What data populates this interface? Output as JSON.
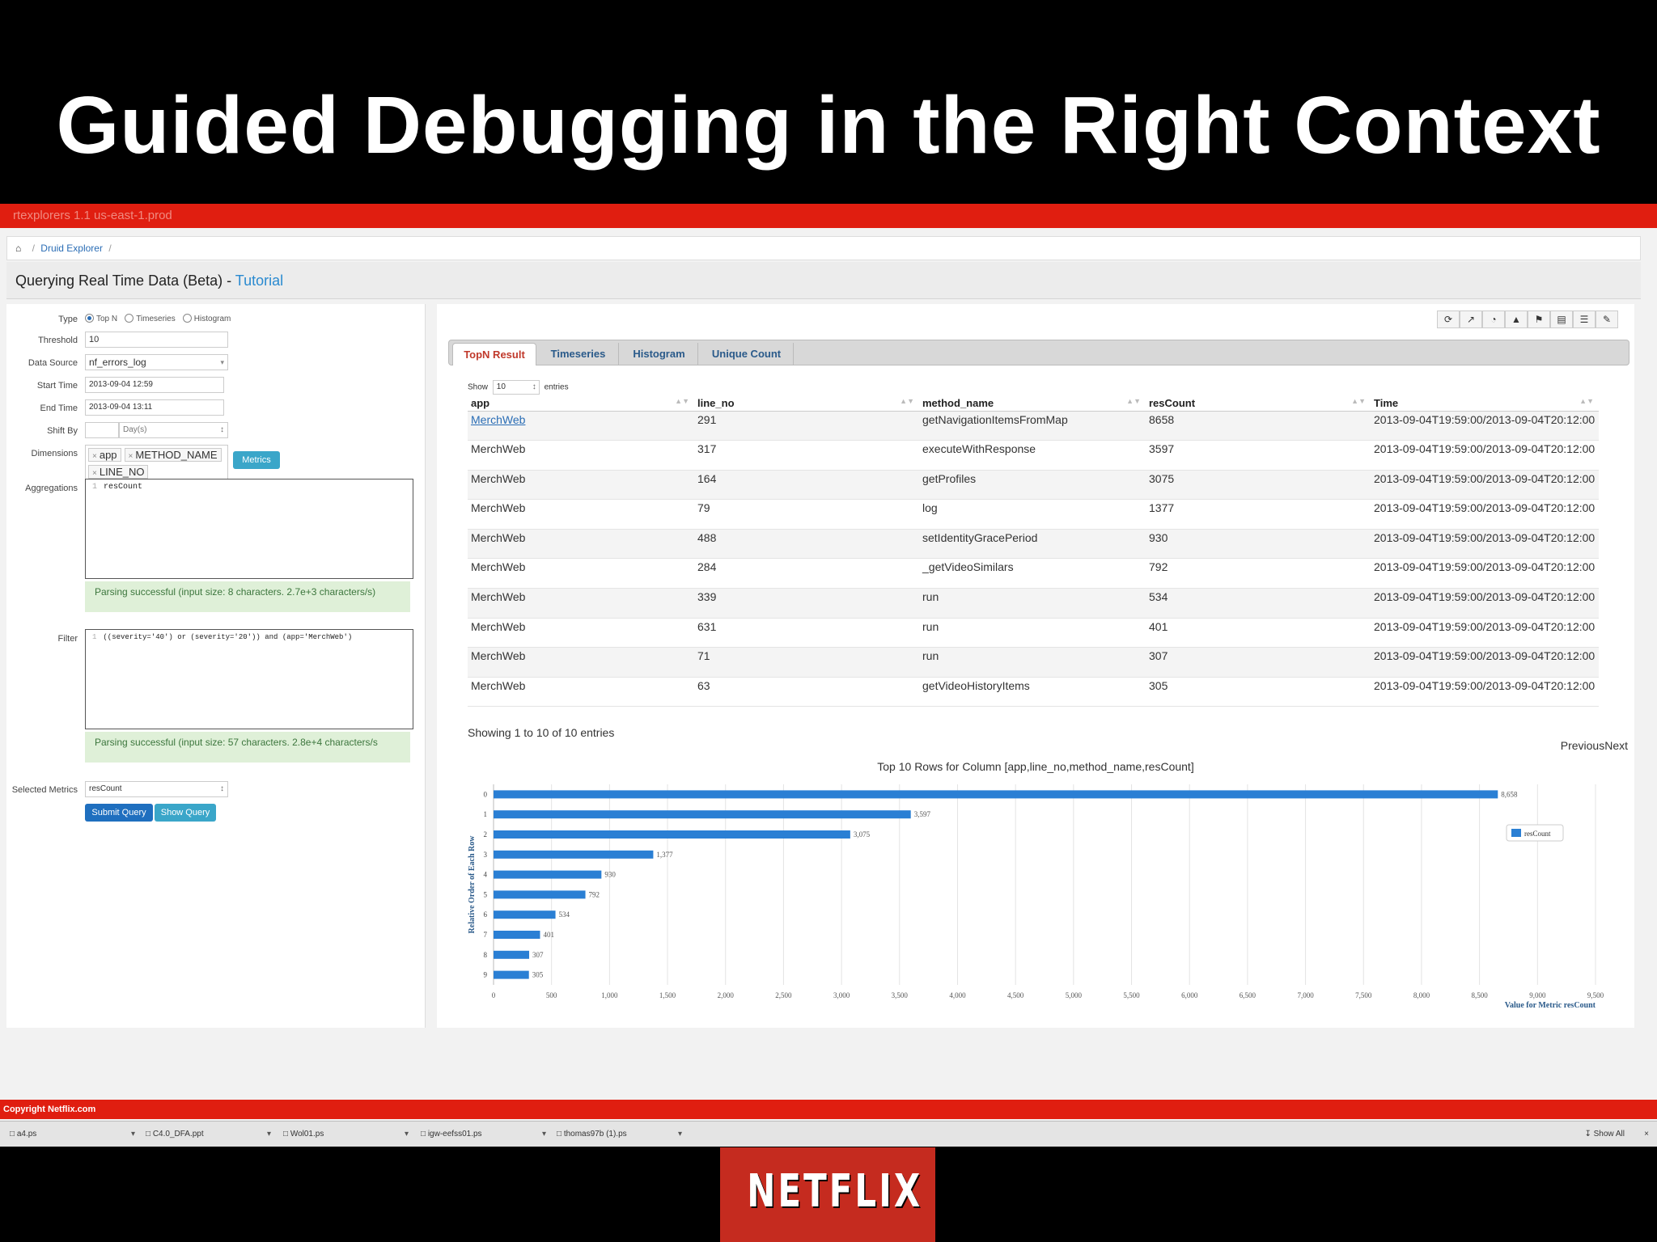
{
  "slide": {
    "title": "Guided Debugging in the Right Context"
  },
  "app": {
    "window_title": "rtexplorers 1.1 us-east-1.prod",
    "breadcrumb": [
      "Druid Explorer"
    ],
    "header": {
      "title": "Querying Real Time Data (Beta) - ",
      "tutorial_link": "Tutorial"
    }
  },
  "form": {
    "type_label": "Type",
    "type_options": [
      "Top N",
      "Timeseries",
      "Histogram"
    ],
    "type_selected": "Top N",
    "threshold_label": "Threshold",
    "threshold_value": "10",
    "datasource_label": "Data Source",
    "datasource_value": "nf_errors_log",
    "start_label": "Start Time",
    "start_value": "2013-09-04 12:59",
    "end_label": "End Time",
    "end_value": "2013-09-04 13:11",
    "shift_label": "Shift By",
    "shift_value": "",
    "shift_unit": "Day(s)",
    "dimensions_label": "Dimensions",
    "dimensions": [
      "app",
      "METHOD_NAME",
      "LINE_NO"
    ],
    "metrics_button": "Metrics",
    "aggregations_label": "Aggregations",
    "aggregations_code": "resCount",
    "aggregations_status": "Parsing successful (input size: 8 characters. 2.7e+3 characters/s)",
    "filter_label": "Filter",
    "filter_code": "((severity='40') or (severity='20')) and (app='MerchWeb')",
    "filter_status": "Parsing successful (input size: 57 characters. 2.8e+4 characters/s",
    "selected_metrics_label": "Selected Metrics",
    "selected_metrics_value": "resCount",
    "submit_button": "Submit Query",
    "show_query_button": "Show Query"
  },
  "results": {
    "tabs": [
      "TopN Result",
      "Timeseries",
      "Histogram",
      "Unique Count"
    ],
    "active_tab": "TopN Result",
    "show_label": "Show",
    "show_value": "10",
    "entries_label": "entries",
    "columns": [
      "app",
      "line_no",
      "method_name",
      "resCount",
      "Time"
    ],
    "rows": [
      [
        "MerchWeb",
        "291",
        "getNavigationItemsFromMap",
        "8658",
        "2013-09-04T19:59:00/2013-09-04T20:12:00"
      ],
      [
        "MerchWeb",
        "317",
        "executeWithResponse",
        "3597",
        "2013-09-04T19:59:00/2013-09-04T20:12:00"
      ],
      [
        "MerchWeb",
        "164",
        "getProfiles",
        "3075",
        "2013-09-04T19:59:00/2013-09-04T20:12:00"
      ],
      [
        "MerchWeb",
        "79",
        "log",
        "1377",
        "2013-09-04T19:59:00/2013-09-04T20:12:00"
      ],
      [
        "MerchWeb",
        "488",
        "setIdentityGracePeriod",
        "930",
        "2013-09-04T19:59:00/2013-09-04T20:12:00"
      ],
      [
        "MerchWeb",
        "284",
        "_getVideoSimilars",
        "792",
        "2013-09-04T19:59:00/2013-09-04T20:12:00"
      ],
      [
        "MerchWeb",
        "339",
        "run",
        "534",
        "2013-09-04T19:59:00/2013-09-04T20:12:00"
      ],
      [
        "MerchWeb",
        "631",
        "run",
        "401",
        "2013-09-04T19:59:00/2013-09-04T20:12:00"
      ],
      [
        "MerchWeb",
        "71",
        "run",
        "307",
        "2013-09-04T19:59:00/2013-09-04T20:12:00"
      ],
      [
        "MerchWeb",
        "63",
        "getVideoHistoryItems",
        "305",
        "2013-09-04T19:59:00/2013-09-04T20:12:00"
      ]
    ],
    "showing_text": "Showing 1 to 10 of 10 entries",
    "previous_label": "Previous",
    "next_label": "Next"
  },
  "chart_data": {
    "type": "bar",
    "orientation": "horizontal",
    "title": "Top 10 Rows for Column [app,line_no,method_name,resCount]",
    "xlabel": "Value for Metric resCount",
    "ylabel": "Relative Order of Each Row",
    "categories": [
      "0",
      "1",
      "2",
      "3",
      "4",
      "5",
      "6",
      "7",
      "8",
      "9"
    ],
    "series": [
      {
        "name": "resCount",
        "values": [
          8658,
          3597,
          3075,
          1377,
          930,
          792,
          534,
          401,
          307,
          305
        ]
      }
    ],
    "data_labels": [
      "8,658",
      "3,597",
      "3,075",
      "1,377",
      "930",
      "792",
      "534",
      "401",
      "307",
      "305"
    ],
    "xlim": [
      0,
      9500
    ],
    "xticks": [
      "0",
      "500",
      "1,000",
      "1,500",
      "2,000",
      "2,500",
      "3,000",
      "3,500",
      "4,000",
      "4,500",
      "5,000",
      "5,500",
      "6,000",
      "6,500",
      "7,000",
      "7,500",
      "8,000",
      "8,500",
      "9,000",
      "9,500"
    ],
    "grid": true,
    "legend_position": "top-right",
    "bar_color": "#2a7fd4"
  },
  "footer": {
    "copyright": "Copyright Netflix.com",
    "downloads": [
      "a4.ps",
      "C4.0_DFA.ppt",
      "Wol01.ps",
      "igw-eefss01.ps",
      "thomas97b (1).ps"
    ],
    "show_all": "Show All"
  },
  "logo": {
    "text": "NETFLIX"
  },
  "colors": {
    "accent_red": "#e01e10",
    "link_blue": "#2a6db5",
    "button_blue": "#1f6fbf",
    "button_teal": "#3aa6c9"
  }
}
